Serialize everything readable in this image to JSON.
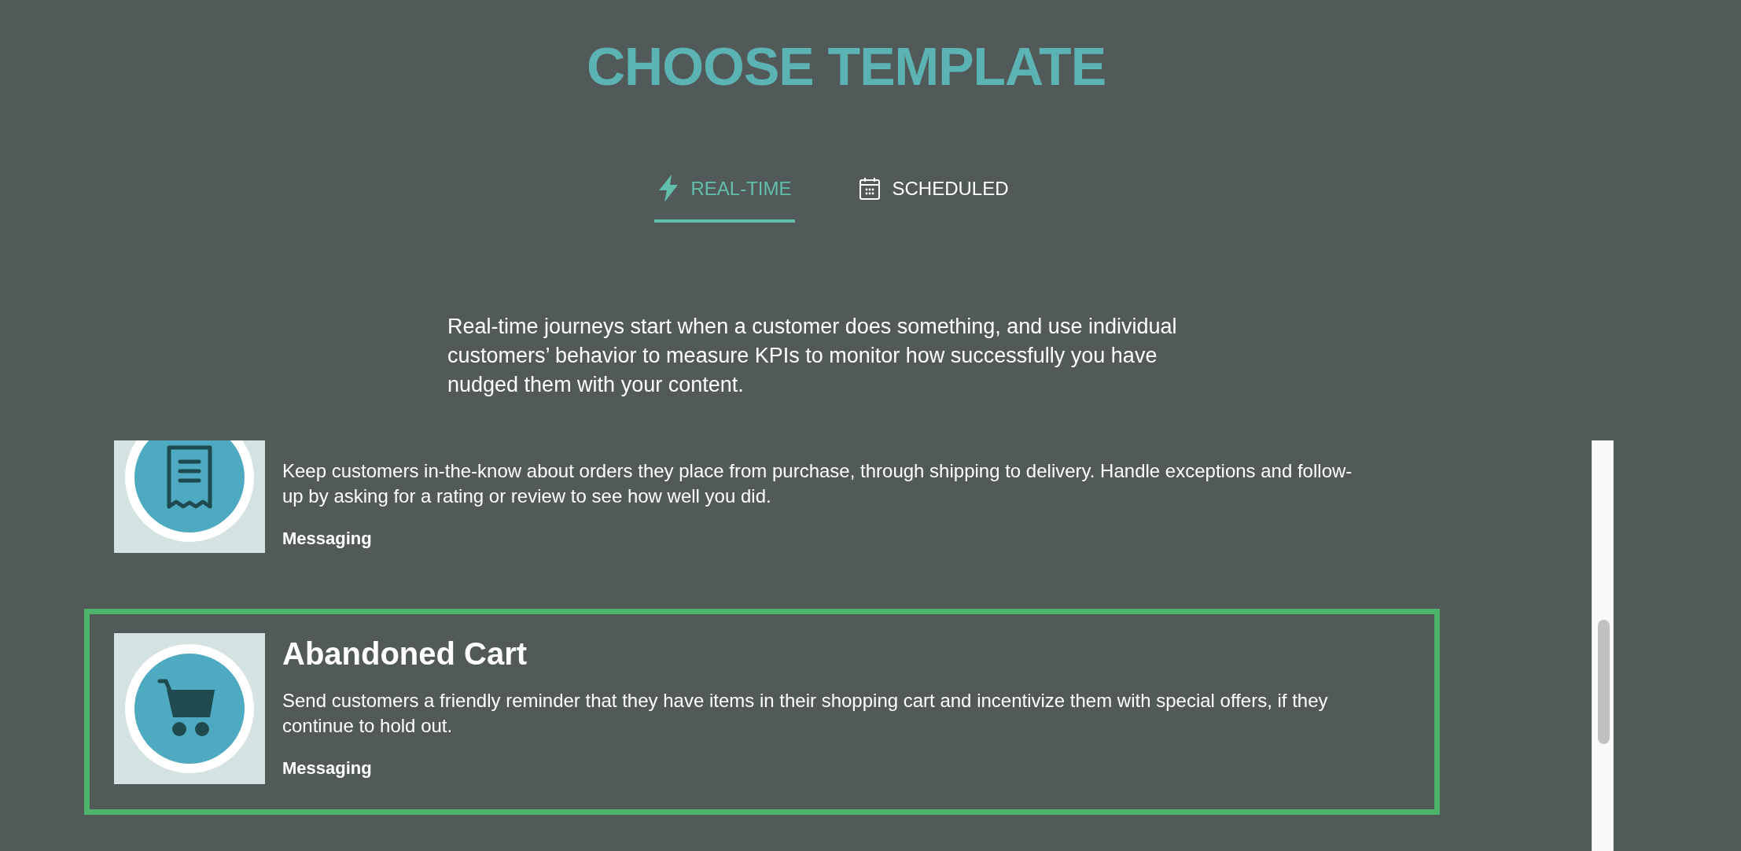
{
  "page": {
    "title": "CHOOSE TEMPLATE"
  },
  "tabs": [
    {
      "label": "REAL-TIME",
      "kind": "realtime",
      "selected": true
    },
    {
      "label": "SCHEDULED",
      "kind": "scheduled",
      "selected": false
    }
  ],
  "intro": "Real-time journeys start when a customer does something, and use individual customers’ behavior to measure KPIs to monitor how successfully you have nudged them with your content.",
  "templates": [
    {
      "kind": "orders",
      "description": "Keep customers in-the-know about orders they place from purchase, through shipping to delivery. Handle exceptions and follow-up by asking for a rating or review to see how well you did.",
      "category": "Messaging",
      "selected": false
    },
    {
      "kind": "cart",
      "title": "Abandoned Cart",
      "description": "Send customers a friendly reminder that they have items in their shopping cart and incentivize them with special offers, if they continue to hold out.",
      "category": "Messaging",
      "selected": true
    }
  ]
}
